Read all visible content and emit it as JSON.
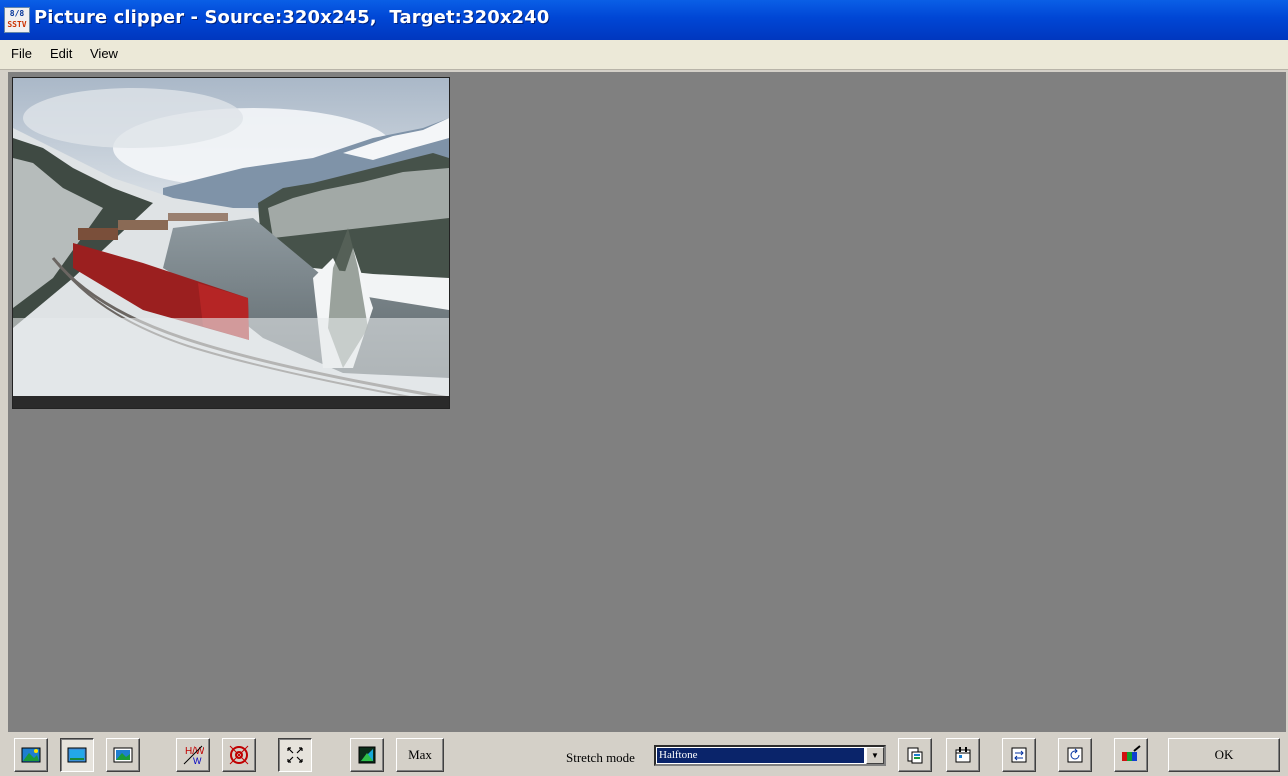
{
  "window": {
    "title": "Picture clipper - Source:320x245,  Target:320x240",
    "icon_top": "8/8",
    "icon_bottom": "SSTV"
  },
  "menu": {
    "items": [
      {
        "label": "File"
      },
      {
        "label": "Edit"
      },
      {
        "label": "View"
      }
    ]
  },
  "picture": {
    "subject": "snowy-mountain-train-photo"
  },
  "toolbar": {
    "buttons": [
      {
        "icon": "picture-icon",
        "pressed": false
      },
      {
        "icon": "picture-fit-icon",
        "pressed": true
      },
      {
        "icon": "picture-frame-icon",
        "pressed": false
      },
      {
        "icon": "aspect-ratio-hw-icon",
        "label": "H/W",
        "pressed": false
      },
      {
        "icon": "center-target-icon",
        "pressed": false
      },
      {
        "icon": "expand-arrows-icon",
        "pressed": true
      },
      {
        "icon": "color-square-icon",
        "pressed": false
      }
    ],
    "max_label": "Max",
    "stretch_label": "Stretch mode",
    "stretch_value": "Halftone",
    "right_buttons": [
      {
        "icon": "paste-icon"
      },
      {
        "icon": "calendar-copy-icon"
      },
      {
        "icon": "flip-icon"
      },
      {
        "icon": "rotate-icon"
      },
      {
        "icon": "color-adjust-icon"
      }
    ],
    "ok_label": "OK"
  },
  "colors": {
    "titlebar": "#0046d5",
    "canvas_background": "#808080",
    "selection": "#0a246a"
  }
}
